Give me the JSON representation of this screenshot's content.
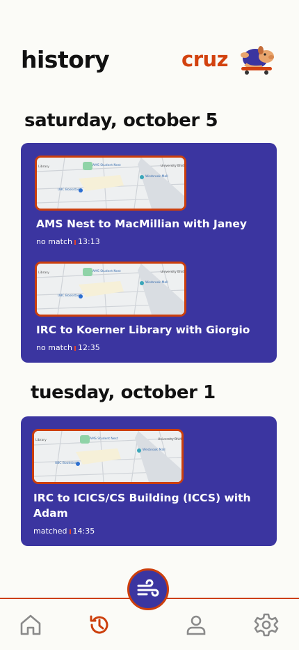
{
  "header": {
    "title": "history",
    "brand": "cruz"
  },
  "days": [
    {
      "label": "saturday, october 5",
      "trips": [
        {
          "title": "AMS Nest to MacMillian with Janey",
          "status": "no match",
          "time": "13:13"
        },
        {
          "title": "IRC to Koerner Library with Giorgio",
          "status": "no match",
          "time": "12:35"
        }
      ]
    },
    {
      "label": "tuesday, october 1",
      "trips": [
        {
          "title": "IRC to ICICS/CS Building (ICCS) with Adam",
          "status": "matched",
          "time": "14:35"
        }
      ]
    }
  ],
  "map_labels": {
    "a": "AMS Student Nest",
    "b": "Wesbrook Mall",
    "c": "UBC Bookstore",
    "d": "University Blvd",
    "e": "Library"
  },
  "nav": {
    "items": [
      "home-icon",
      "history-icon",
      "profile-icon",
      "settings-icon"
    ],
    "active": "history-icon",
    "fab_icon": "wind-icon"
  },
  "colors": {
    "accent": "#cc3f0c",
    "card": "#3b35a0",
    "background": "#fbfbf7",
    "nav_icon": "#8a8a8a"
  }
}
